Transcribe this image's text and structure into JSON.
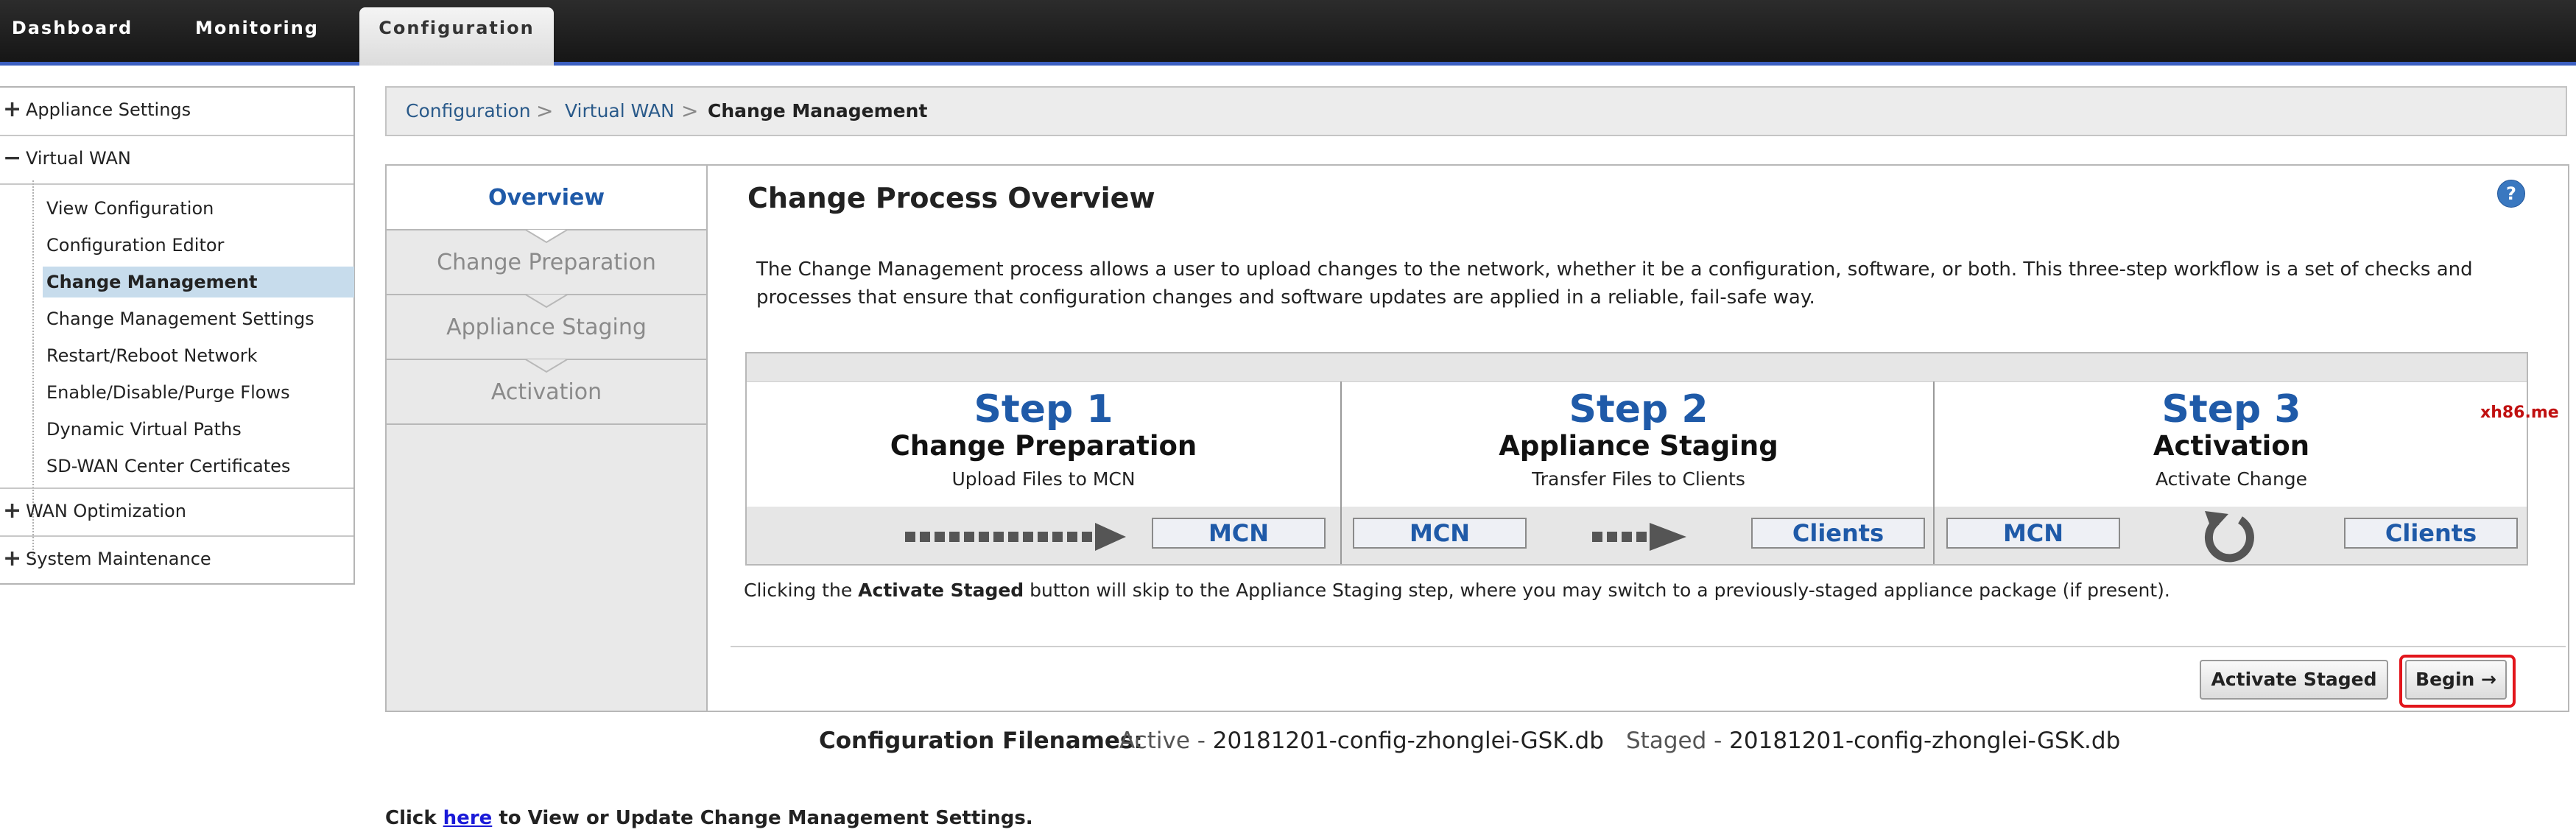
{
  "nav": {
    "tabs": [
      {
        "label": "Dashboard"
      },
      {
        "label": "Monitoring"
      },
      {
        "label": "Configuration"
      }
    ]
  },
  "sidebar": {
    "groups": {
      "appliance_settings": "Appliance Settings",
      "virtual_wan": "Virtual WAN",
      "wan_optimization": "WAN Optimization",
      "system_maintenance": "System Maintenance"
    },
    "virtual_wan_items": [
      "View Configuration",
      "Configuration Editor",
      "Change Management",
      "Change Management Settings",
      "Restart/Reboot Network",
      "Enable/Disable/Purge Flows",
      "Dynamic Virtual Paths",
      "SD-WAN Center Certificates"
    ],
    "expand_symbol": "+",
    "collapse_symbol": "−"
  },
  "breadcrumb": {
    "items": [
      "Configuration",
      "Virtual WAN",
      "Change Management"
    ],
    "separator": ">"
  },
  "steps_nav": [
    "Overview",
    "Change Preparation",
    "Appliance Staging",
    "Activation"
  ],
  "overview": {
    "title": "Change Process Overview",
    "help": "?",
    "description": "The Change Management process allows a user to upload changes to the network, whether it be a configuration, software, or both. This three-step workflow is a set of checks and processes that ensure that configuration changes and software updates are applied in a reliable, fail-safe way.",
    "steps": [
      {
        "step": "Step 1",
        "name": "Change Preparation",
        "sub": "Upload Files to MCN",
        "boxes": [
          "MCN"
        ]
      },
      {
        "step": "Step 2",
        "name": "Appliance Staging",
        "sub": "Transfer Files to Clients",
        "boxes": [
          "MCN",
          "Clients"
        ]
      },
      {
        "step": "Step 3",
        "name": "Activation",
        "sub": "Activate Change",
        "boxes": [
          "MCN",
          "Clients"
        ]
      }
    ],
    "note_pre": "Clicking the ",
    "note_bold": "Activate Staged",
    "note_post": " button will skip to the Appliance Staging step, where you may switch to a previously-staged appliance package (if present).",
    "buttons": {
      "activate_staged": "Activate Staged",
      "begin": "Begin →"
    }
  },
  "filenames": {
    "label": "Configuration Filenames:",
    "active_prefix": "Active - ",
    "active_file": "20181201-config-zhonglei-GSK.db",
    "staged_prefix": "Staged - ",
    "staged_file": "20181201-config-zhonglei-GSK.db"
  },
  "footer": {
    "pre": "Click ",
    "link": "here",
    "post": " to View or Update Change Management Settings."
  },
  "watermark": "xh86.me",
  "colors": {
    "accent_blue": "#1f5aa8",
    "nav_bar": "#1c1c1c",
    "nav_underline": "#3b5fc0",
    "selection": "#c7dcec",
    "highlight_ring": "#e2151b"
  }
}
